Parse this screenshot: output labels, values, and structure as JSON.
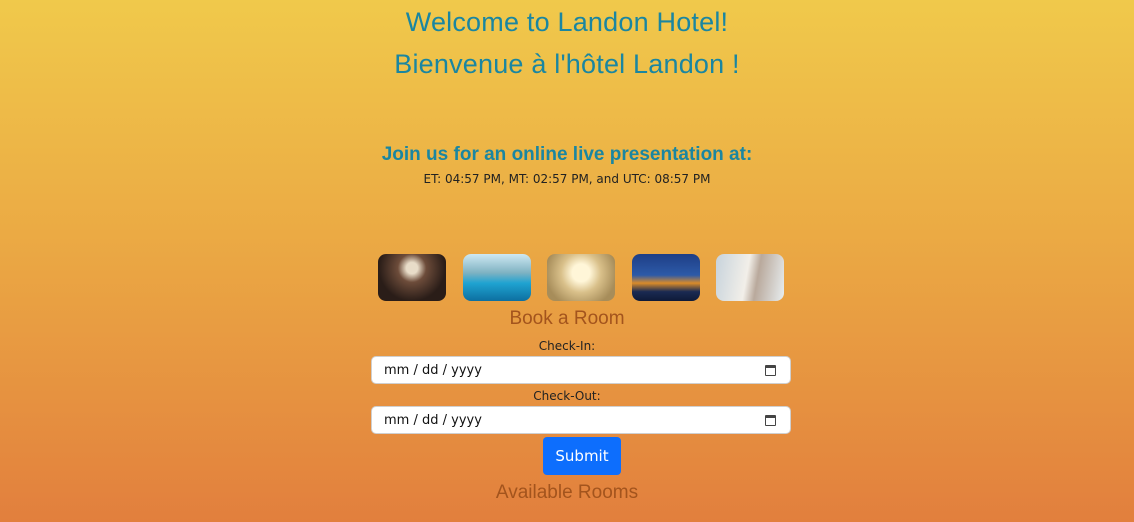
{
  "header": {
    "title_en": "Welcome to Landon Hotel!",
    "title_fr": "Bienvenue à l'hôtel Landon !"
  },
  "presentation": {
    "heading": "Join us for an online live presentation at:",
    "times": "ET: 04:57 PM, MT: 02:57 PM, and UTC: 08:57 PM"
  },
  "gallery": {
    "images": [
      {
        "name": "bedroom-image"
      },
      {
        "name": "pool-image"
      },
      {
        "name": "dining-hall-image"
      },
      {
        "name": "london-parliament-image"
      },
      {
        "name": "wedding-couple-image"
      }
    ]
  },
  "booking": {
    "heading": "Book a Room",
    "checkin_label": "Check-In:",
    "checkin_placeholder": "mm / dd / yyyy",
    "checkout_label": "Check-Out:",
    "checkout_placeholder": "mm / dd / yyyy",
    "calendar_icon": "calendar-icon",
    "submit_label": "Submit",
    "submit_color": "#0d6efd"
  },
  "rooms": {
    "heading": "Available Rooms"
  },
  "colors": {
    "title": "#1a86a1",
    "section_heading": "#a3541d",
    "bg_top": "#f0c94b",
    "bg_bottom": "#e27f3d"
  }
}
